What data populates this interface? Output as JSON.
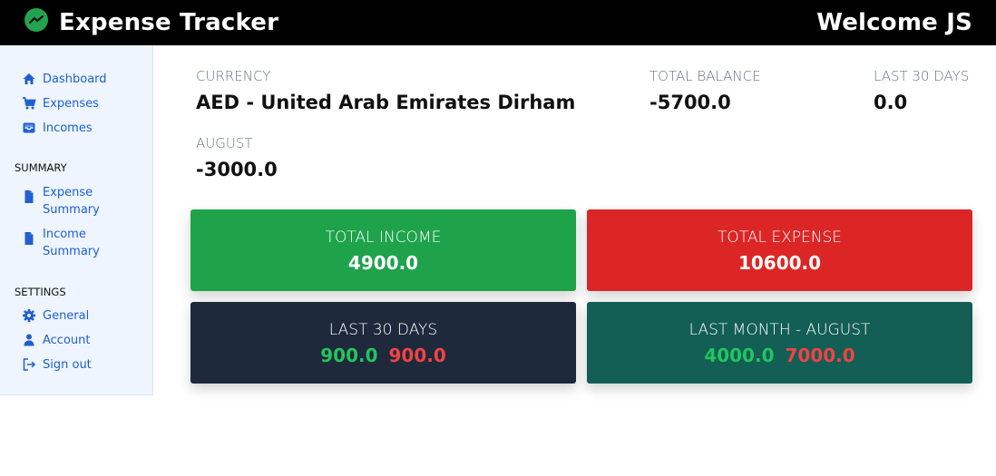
{
  "header": {
    "app_title": "Expense Tracker",
    "welcome": "Welcome JS"
  },
  "sidebar": {
    "nav": [
      {
        "label": "Dashboard",
        "icon": "home-icon"
      },
      {
        "label": "Expenses",
        "icon": "cart-icon"
      },
      {
        "label": "Incomes",
        "icon": "inbox-icon"
      }
    ],
    "summary_title": "SUMMARY",
    "summary": [
      {
        "label": "Expense Summary",
        "icon": "document-icon"
      },
      {
        "label": "Income Summary",
        "icon": "document-icon"
      }
    ],
    "settings_title": "SETTINGS",
    "settings": [
      {
        "label": "General",
        "icon": "gear-icon"
      },
      {
        "label": "Account",
        "icon": "user-icon"
      },
      {
        "label": "Sign out",
        "icon": "sign-out-icon"
      }
    ]
  },
  "stats": {
    "currency_label": "CURRENCY",
    "currency_value": "AED - United Arab Emirates Dirham",
    "balance_label": "TOTAL BALANCE",
    "balance_value": "-5700.0",
    "last30_label": "LAST 30 DAYS",
    "last30_value": "0.0",
    "month_label": "AUGUST",
    "month_value": "-3000.0"
  },
  "cards": {
    "income": {
      "title": "TOTAL INCOME",
      "value": "4900.0"
    },
    "expense": {
      "title": "TOTAL EXPENSE",
      "value": "10600.0"
    },
    "last30": {
      "title": "LAST 30 DAYS",
      "income": "900.0",
      "expense": "900.0"
    },
    "last_month": {
      "title": "LAST MONTH - AUGUST",
      "income": "4000.0",
      "expense": "7000.0"
    }
  },
  "colors": {
    "income_card": "#1ea34b",
    "expense_card": "#dc2626",
    "last30_card": "#1e293b",
    "last_month_card": "#135e55",
    "link": "#1f5fd1"
  }
}
